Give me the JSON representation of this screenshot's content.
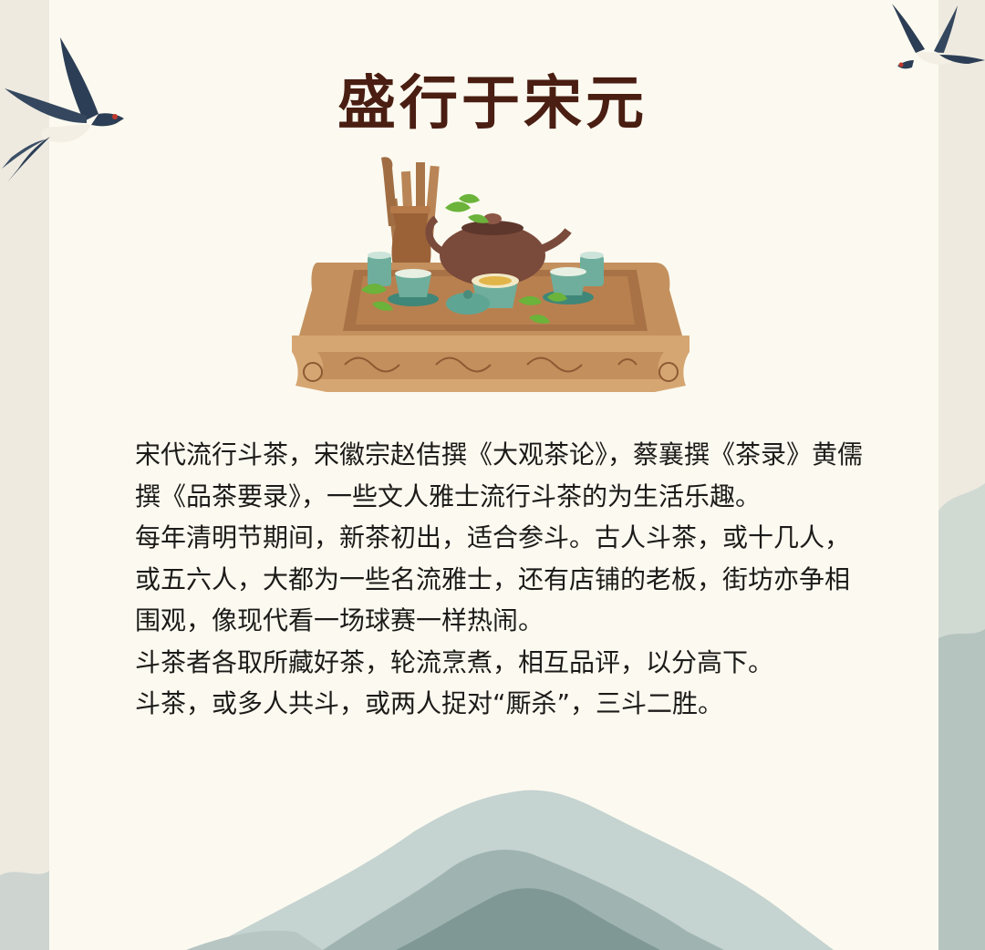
{
  "title": "盛行于宋元",
  "paragraphs": [
    "宋代流行斗茶，宋徽宗赵佶撰《大观茶论》，蔡襄撰《茶录》黄儒撰《品茶要录》，一些文人雅士流行斗茶的为生活乐趣。",
    "每年清明节期间，新茶初出，适合参斗。古人斗茶，或十几人，或五六人，大都为一些名流雅士，还有店铺的老板，街坊亦争相围观，像现代看一场球赛一样热闹。",
    "斗茶者各取所藏好茶，轮流烹煮，相互品评，以分高下。",
    "斗茶，或多人共斗，或两人捉对“厮杀”，三斗二胜。"
  ]
}
